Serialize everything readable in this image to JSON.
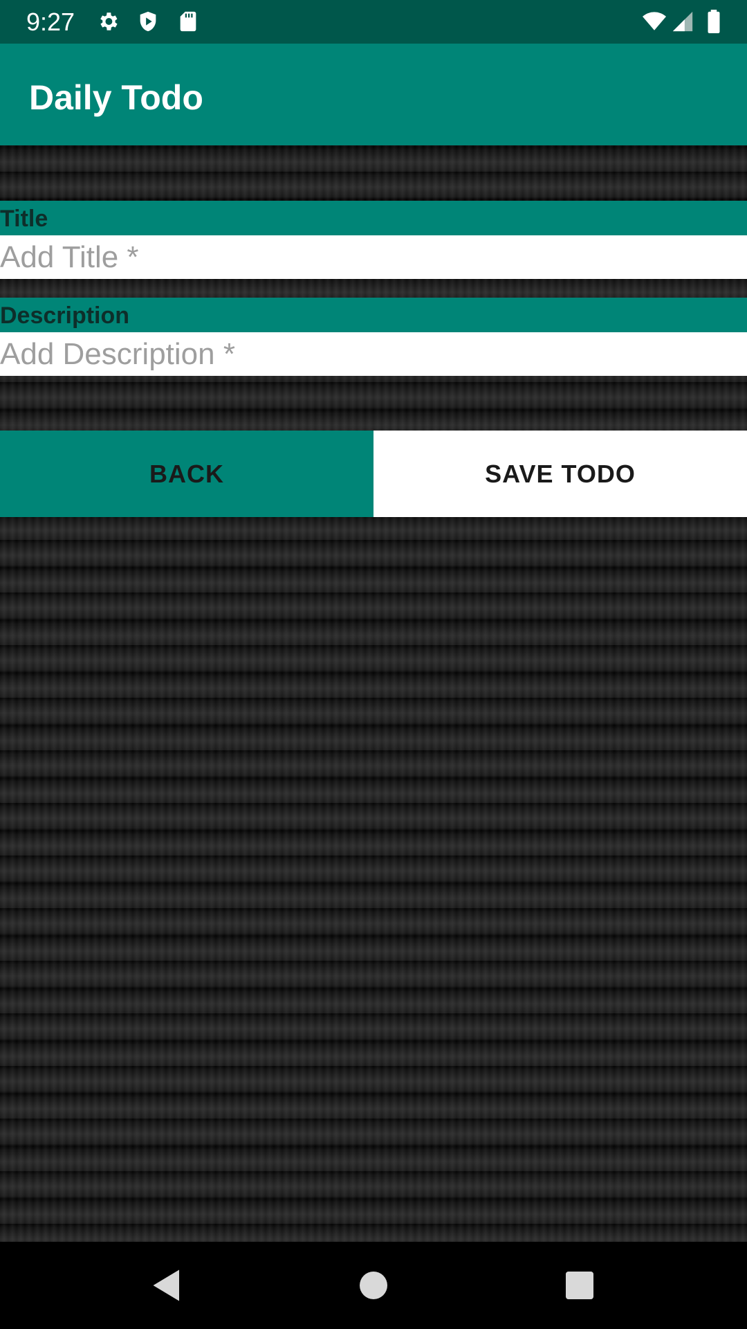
{
  "status_bar": {
    "time": "9:27",
    "left_icons": [
      "gear-icon",
      "shield-play-icon",
      "sd-card-icon"
    ],
    "right_icons": [
      "wifi-icon",
      "cell-signal-icon",
      "battery-icon"
    ]
  },
  "app_bar": {
    "title": "Daily Todo",
    "color": "#008577"
  },
  "form": {
    "title_label": "Title",
    "title_placeholder": "Add Title *",
    "title_value": "",
    "description_label": "Description",
    "description_placeholder": "Add Description *",
    "description_value": ""
  },
  "buttons": {
    "back_label": "BACK",
    "save_label": "SAVE TODO"
  },
  "nav_bar": {
    "icons": [
      "back-triangle-icon",
      "home-circle-icon",
      "recents-square-icon"
    ]
  },
  "colors": {
    "accent": "#008577",
    "status_bar": "#00574b",
    "label_text": "#0e2e2a"
  }
}
